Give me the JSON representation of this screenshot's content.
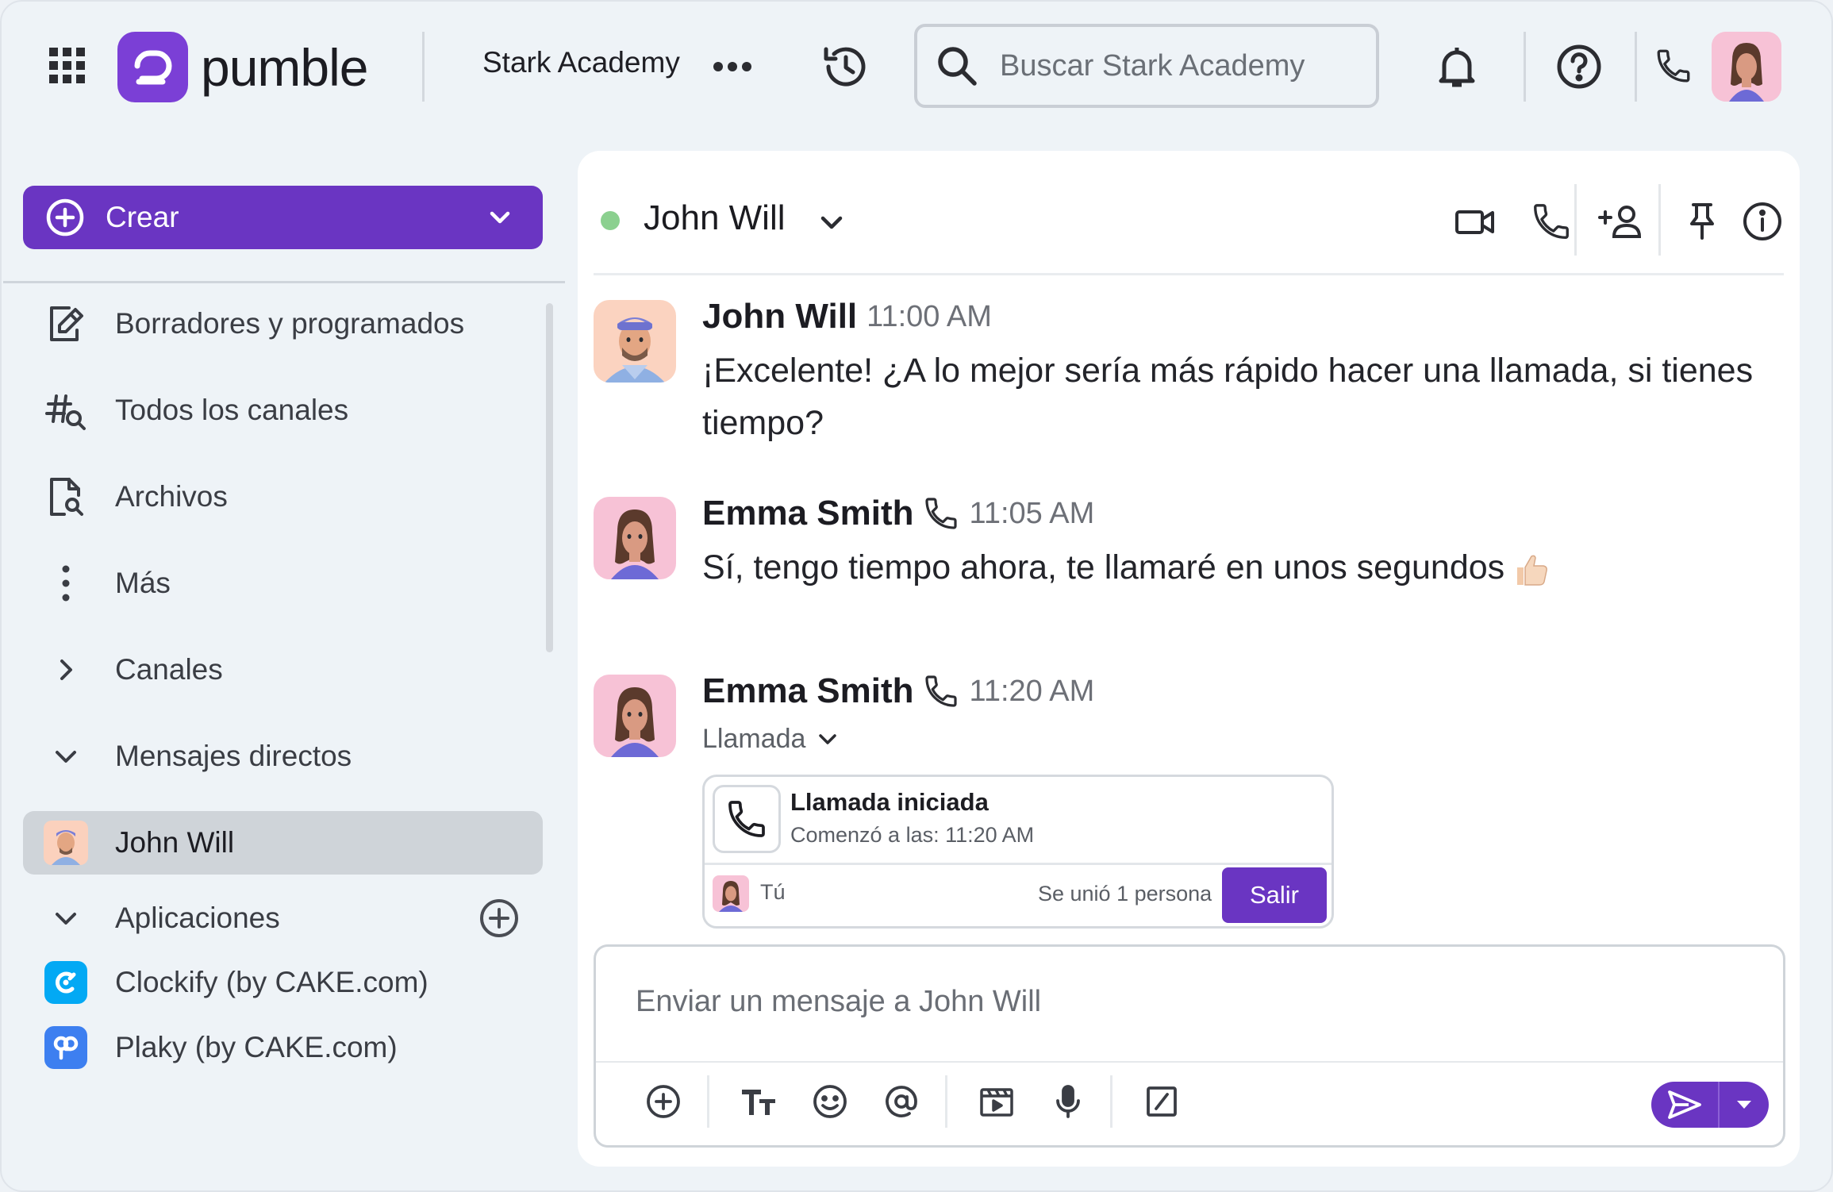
{
  "app": {
    "name": "pumble",
    "brand_color": "#6a35c2"
  },
  "header": {
    "workspace_name": "Stark Academy",
    "search": {
      "placeholder": "Buscar Stark Academy"
    },
    "icons": [
      "apps-grid-icon",
      "more-dots-icon",
      "history-icon",
      "search-icon",
      "bell-icon",
      "help-icon",
      "phone-icon"
    ]
  },
  "sidebar": {
    "create_label": "Crear",
    "items": [
      {
        "label": "Borradores y programados",
        "icon": "drafts-icon"
      },
      {
        "label": "Todos los canales",
        "icon": "channel-search-icon"
      },
      {
        "label": "Archivos",
        "icon": "files-icon"
      },
      {
        "label": "Más",
        "icon": "more-vertical-icon"
      }
    ],
    "sections": {
      "channels": "Canales",
      "direct_messages": "Mensajes directos",
      "apps": "Aplicaciones"
    },
    "direct_messages": [
      {
        "label": "John Will",
        "active": true
      }
    ],
    "apps": [
      {
        "label": "Clockify (by CAKE.com)",
        "color": "#03a9f4"
      },
      {
        "label": "Plaky (by CAKE.com)",
        "color": "#3d7ff0"
      }
    ]
  },
  "chat": {
    "title": "John Will",
    "status": "online",
    "status_color": "#8bd08f",
    "header_icons": [
      "video-icon",
      "phone-icon",
      "add-person-icon",
      "pin-icon",
      "info-icon"
    ],
    "messages": [
      {
        "author": "John Will",
        "time": "11:00 AM",
        "text": "¡Excelente! ¿A lo mejor sería más rápido hacer una llamada, si tienes tiempo?"
      },
      {
        "author": "Emma Smith",
        "time": "11:05 AM",
        "text": "Sí, tengo tiempo ahora, te llamaré en unos segundos",
        "emoji": "thumbs-up-icon"
      },
      {
        "author": "Emma Smith",
        "time": "11:20 AM",
        "call": {
          "toggle_label": "Llamada",
          "title": "Llamada iniciada",
          "started": "Comenzó a las: 11:20 AM",
          "you": "Tú",
          "joined": "Se unió 1 persona",
          "leave_label": "Salir"
        }
      }
    ],
    "composer": {
      "placeholder": "Enviar un mensaje a John Will",
      "tools": [
        "add-icon",
        "text-format-icon",
        "emoji-icon",
        "mention-icon",
        "gif-icon",
        "microphone-icon",
        "slash-command-icon"
      ]
    }
  }
}
